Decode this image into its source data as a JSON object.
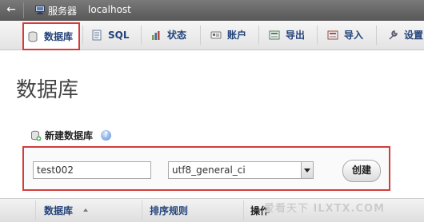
{
  "titlebar": {
    "back_glyph": "←",
    "server_label": "服务器",
    "host": "localhost"
  },
  "tabs": [
    {
      "label": "数据库",
      "icon": "database-icon",
      "active": true
    },
    {
      "label": "SQL",
      "icon": "sql-icon",
      "active": false
    },
    {
      "label": "状态",
      "icon": "status-icon",
      "active": false
    },
    {
      "label": "账户",
      "icon": "users-icon",
      "active": false
    },
    {
      "label": "导出",
      "icon": "export-icon",
      "active": false
    },
    {
      "label": "导入",
      "icon": "import-icon",
      "active": false
    },
    {
      "label": "设置",
      "icon": "settings-icon",
      "active": false
    }
  ],
  "page_title": "数据库",
  "create_db": {
    "heading": "新建数据库",
    "help_glyph": "?",
    "name_value": "test002",
    "collation_value": "utf8_general_ci",
    "create_button": "创建"
  },
  "table": {
    "col_database": "数据库",
    "col_collation": "排序规则",
    "col_actions": "操作"
  },
  "watermark": "爱看天下 ILXTX.COM",
  "colors": {
    "highlight_red": "#d43c3c",
    "link_blue": "#23437a",
    "titlebar_gray": "#666666"
  }
}
